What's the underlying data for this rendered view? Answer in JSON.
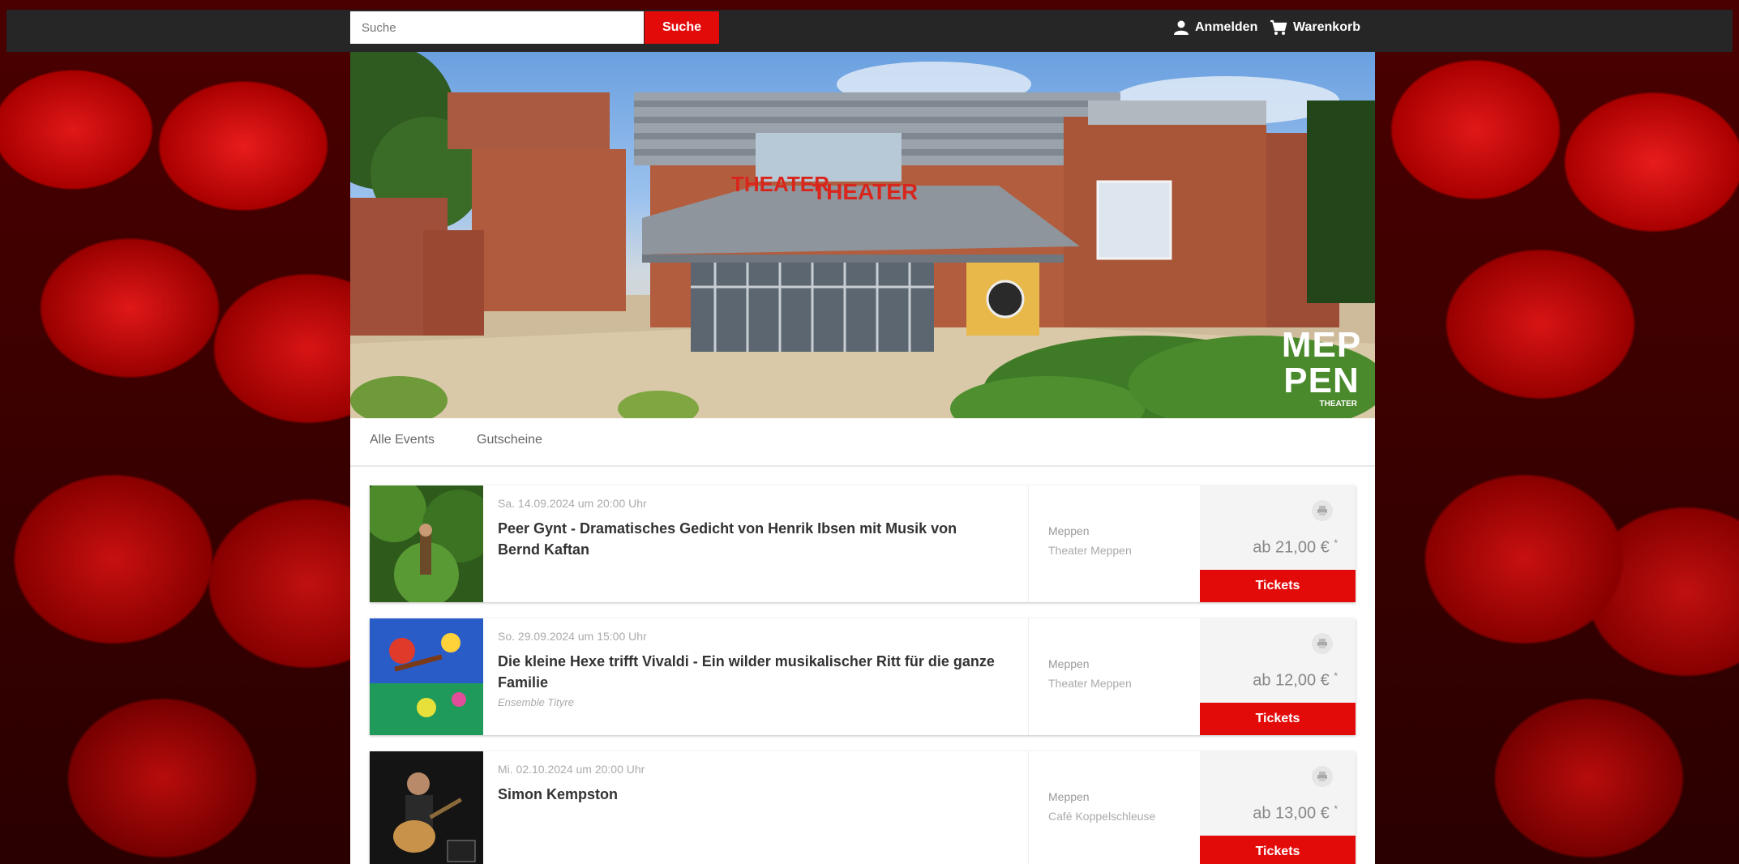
{
  "header": {
    "search_placeholder": "Suche",
    "search_button": "Suche",
    "login": "Anmelden",
    "cart": "Warenkorb"
  },
  "hero": {
    "sign_text": "THEATER",
    "logo_line1": "MEP",
    "logo_line2": "PEN",
    "logo_sub": "THEATER"
  },
  "tabs": [
    "Alle Events",
    "Gutscheine"
  ],
  "events": [
    {
      "date": "Sa. 14.09.2024 um 20:00 Uhr",
      "title": "Peer Gynt - Dramatisches Gedicht von Henrik Ibsen mit Musik von Bernd Kaftan",
      "subtitle": "",
      "city": "Meppen",
      "venue": "Theater Meppen",
      "price": "ab 21,00 €",
      "price_mark": "*",
      "button": "Tickets"
    },
    {
      "date": "So. 29.09.2024 um 15:00 Uhr",
      "title": "Die kleine Hexe trifft Vivaldi - Ein wilder musikalischer Ritt für die ganze Familie",
      "subtitle": "Ensemble Tityre",
      "city": "Meppen",
      "venue": "Theater Meppen",
      "price": "ab 12,00 €",
      "price_mark": "*",
      "button": "Tickets"
    },
    {
      "date": "Mi. 02.10.2024 um 20:00 Uhr",
      "title": "Simon Kempston",
      "subtitle": "",
      "city": "Meppen",
      "venue": "Café Koppelschleuse",
      "price": "ab 13,00 €",
      "price_mark": "*",
      "button": "Tickets"
    }
  ],
  "colors": {
    "accent": "#e30a0a",
    "topbar": "#262626",
    "icons": [
      "user-icon",
      "cart-icon",
      "print-icon"
    ]
  }
}
